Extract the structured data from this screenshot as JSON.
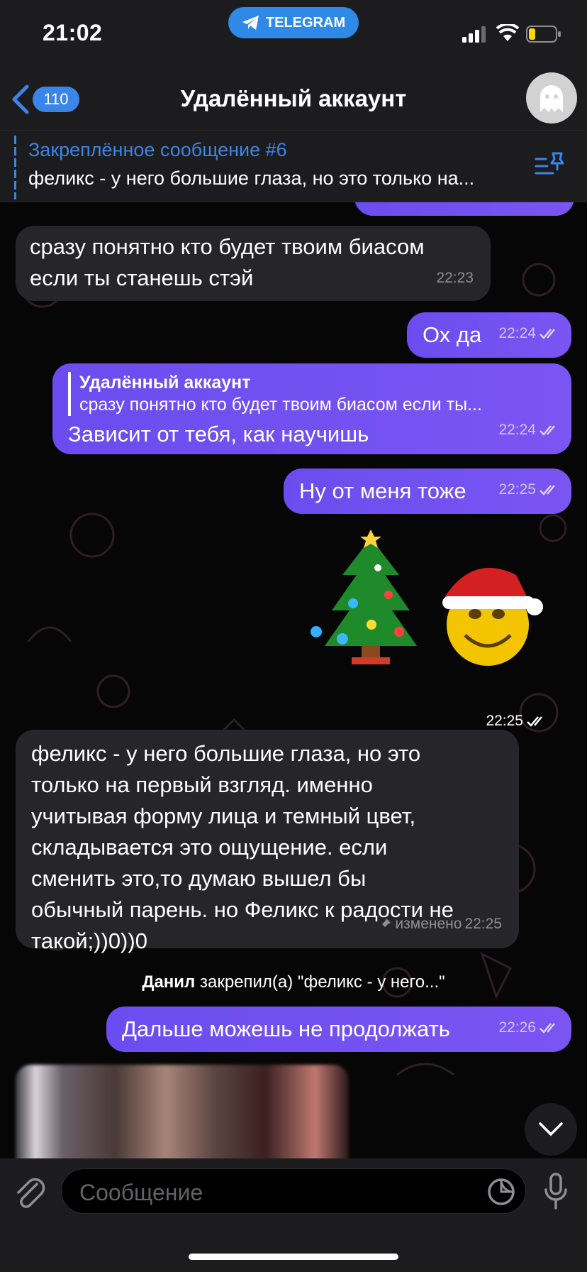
{
  "status": {
    "time": "21:02",
    "app_pill": "TELEGRAM"
  },
  "nav": {
    "back_count": "110",
    "title": "Удалённый аккаунт"
  },
  "pinned": {
    "title": "Закреплённое сообщение #6",
    "text": "феликс - у него большие глаза, но это только на..."
  },
  "messages": {
    "m1": {
      "text_line1": "сразу понятно кто будет твоим биасом",
      "text_line2": "если ты станешь стэй",
      "time": "22:23"
    },
    "m2": {
      "text": "Ох да",
      "time": "22:24"
    },
    "m3": {
      "reply_author": "Удалённый аккаунт",
      "reply_text": "сразу понятно кто будет твоим биасом если ты...",
      "text": "Зависит от тебя, как научишь",
      "time": "22:24"
    },
    "m4": {
      "text": "Ну от меня тоже",
      "time": "22:25"
    },
    "m5": {
      "time": "22:25"
    },
    "m6": {
      "lines": [
        "феликс - у него большие глаза, но это",
        "только на первый взгляд. именно",
        "учитывая форму лица и темный цвет,",
        "складывается это ощущение. если",
        "сменить это,то думаю вышел бы",
        "обычный парень. но Феликс к радости не",
        "такой;))0))0"
      ],
      "edited": "изменено",
      "time": "22:25"
    },
    "service": {
      "actor": "Данил",
      "text": " закрепил(а) \"феликс - у него...\""
    },
    "m7": {
      "text": "Дальше можешь не продолжать",
      "time": "22:26"
    }
  },
  "composer": {
    "placeholder": "Сообщение"
  },
  "colors": {
    "accent": "#3a86e8",
    "outgoing": "#7053f0",
    "incoming": "#262629"
  }
}
